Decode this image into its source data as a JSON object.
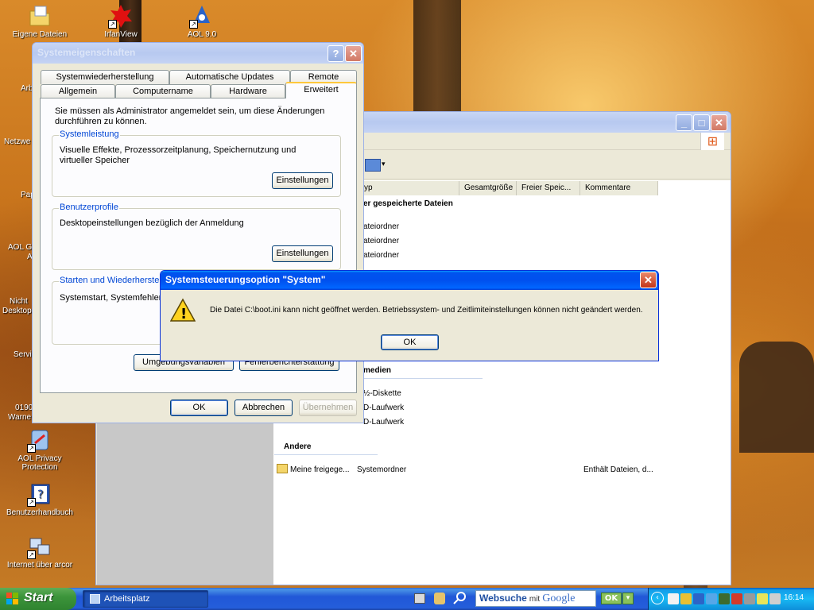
{
  "desktop": {
    "icons": [
      {
        "label": "Eigene Dateien"
      },
      {
        "label": "IrfanView"
      },
      {
        "label": "AOL 9.0"
      },
      {
        "label": "AOL Privacy Protection"
      },
      {
        "label": "Benutzerhandbuch"
      },
      {
        "label": "Internet über arcor"
      }
    ],
    "partial_labels": [
      "Arb",
      "Netzwe",
      "Pap",
      "AOL G",
      "A",
      "Nicht",
      "Desktop",
      "Servi",
      "0190",
      "Warne"
    ]
  },
  "sysprops": {
    "title": "Systemeigenschaften",
    "help_glyph": "?",
    "close_glyph": "✕",
    "tabs_row1": [
      "Systemwiederherstellung",
      "Automatische Updates",
      "Remote"
    ],
    "tabs_row2": [
      "Allgemein",
      "Computername",
      "Hardware",
      "Erweitert"
    ],
    "admin_note": "Sie müssen als Administrator angemeldet sein, um diese Änderungen durchführen zu können.",
    "group_perf": {
      "title": "Systemleistung",
      "text": "Visuelle Effekte, Prozessorzeitplanung, Speichernutzung und virtueller Speicher",
      "button": "Einstellungen"
    },
    "group_profiles": {
      "title": "Benutzerprofile",
      "text": "Desktopeinstellungen bezüglich der Anmeldung",
      "button": "Einstellungen"
    },
    "group_startup": {
      "title": "Starten und Wiederherstelle",
      "text": "Systemstart, Systemfehler u"
    },
    "env_button": "Umgebungsvariablen",
    "error_button": "Fehlerberichterstattung",
    "ok": "OK",
    "cancel": "Abbrechen",
    "apply": "Übernehmen"
  },
  "explorer": {
    "columns": [
      "yp",
      "Gesamtgröße",
      "Freier Speic...",
      "Kommentare"
    ],
    "section_files": "er gespeicherte Dateien",
    "file_rows": [
      "ateiordner",
      "ateiordner",
      "ateiordner"
    ],
    "section_media": "medien",
    "media_rows": [
      "½-Diskette",
      "D-Laufwerk",
      "D-Laufwerk"
    ],
    "section_other": "Andere",
    "shared": {
      "name": "Meine freigege...",
      "type": "Systemordner",
      "comment": "Enthält Dateien, d..."
    },
    "xp_logo": "⊞"
  },
  "dialog": {
    "title": "Systemsteuerungsoption \"System\"",
    "close_glyph": "✕",
    "warning_glyph": "!",
    "message": "Die Datei C:\\boot.ini kann nicht geöffnet werden. Betriebssystem- und Zeitlimiteinstellungen können nicht geändert werden.",
    "ok": "OK"
  },
  "taskbar": {
    "start": "Start",
    "task": "Arbeitsplatz",
    "websuche": "Websuche",
    "mit": "mit",
    "google": "Google",
    "ok": "OK",
    "clock": "16:14"
  }
}
